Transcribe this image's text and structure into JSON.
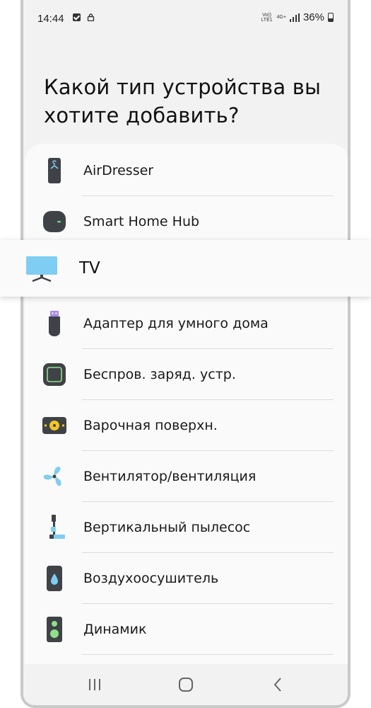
{
  "status_bar": {
    "time": "14:44",
    "network_volte": "Vo)) LTE1",
    "network_4g": "4G+",
    "battery": "36%"
  },
  "heading": "Какой тип устройства вы хотите добавить?",
  "devices": [
    {
      "label": "AirDresser",
      "icon": "airdresser-icon"
    },
    {
      "label": "Smart Home Hub",
      "icon": "smart-home-hub-icon"
    },
    {
      "label": "Адаптер для умного дома",
      "icon": "smart-adapter-icon"
    },
    {
      "label": "Беспров. заряд. устр.",
      "icon": "wireless-charger-icon"
    },
    {
      "label": "Варочная поверхн.",
      "icon": "cooktop-icon"
    },
    {
      "label": "Вентилятор/вентиляция",
      "icon": "fan-icon"
    },
    {
      "label": "Вертикальный пылесос",
      "icon": "stick-vacuum-icon"
    },
    {
      "label": "Воздухоосушитель",
      "icon": "dehumidifier-icon"
    },
    {
      "label": "Динамик",
      "icon": "speaker-icon"
    }
  ],
  "highlighted": {
    "label": "TV",
    "icon": "tv-icon"
  },
  "nav": {
    "recents": "recents-icon",
    "home": "home-icon",
    "back": "back-icon"
  },
  "colors": {
    "accent_light_blue": "#7fcdf2",
    "icon_dark": "#3f4246"
  }
}
